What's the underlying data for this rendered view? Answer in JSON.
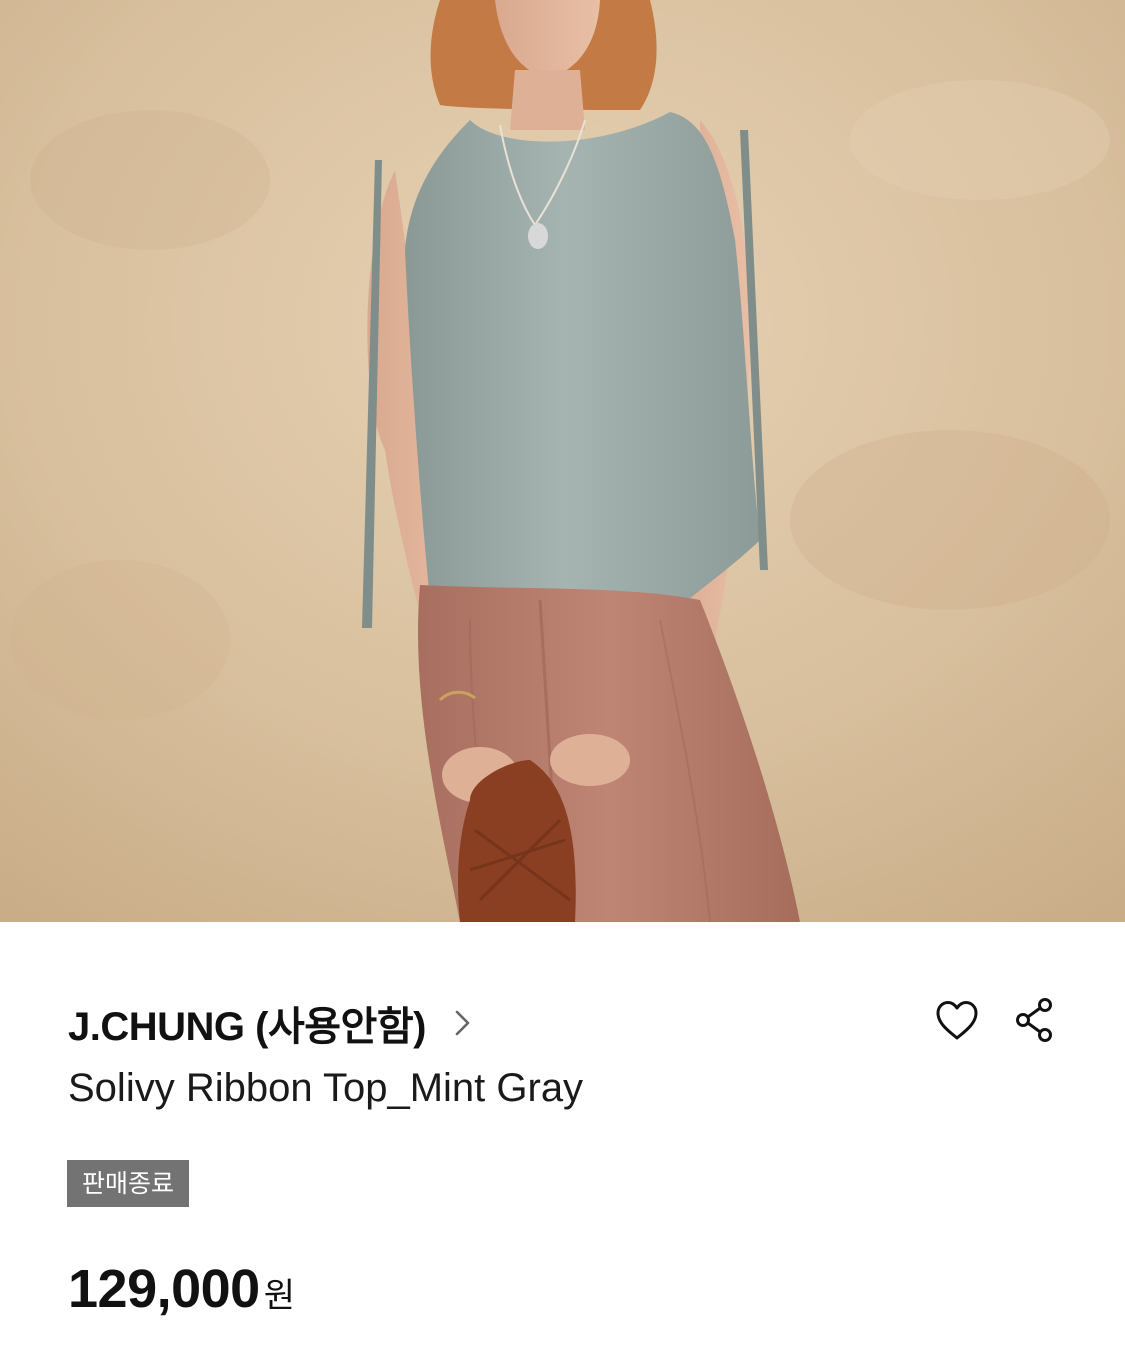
{
  "product": {
    "image_alt": "Model wearing sleeveless mint gray top with ribbon ties and terracotta wide pants",
    "brand": "J.CHUNG (사용안함)",
    "name": "Solivy Ribbon Top_Mint Gray",
    "status_badge": "판매종료",
    "price_amount": "129,000",
    "price_unit": "원"
  },
  "icons": {
    "brand_link": "chevron-right-icon",
    "wishlist": "heart-icon",
    "share": "share-icon"
  },
  "colors": {
    "badge_bg": "#737373",
    "text": "#111111",
    "wall": "#dcc4a4",
    "top": "#9aa9a6",
    "pants": "#b77c6c"
  }
}
